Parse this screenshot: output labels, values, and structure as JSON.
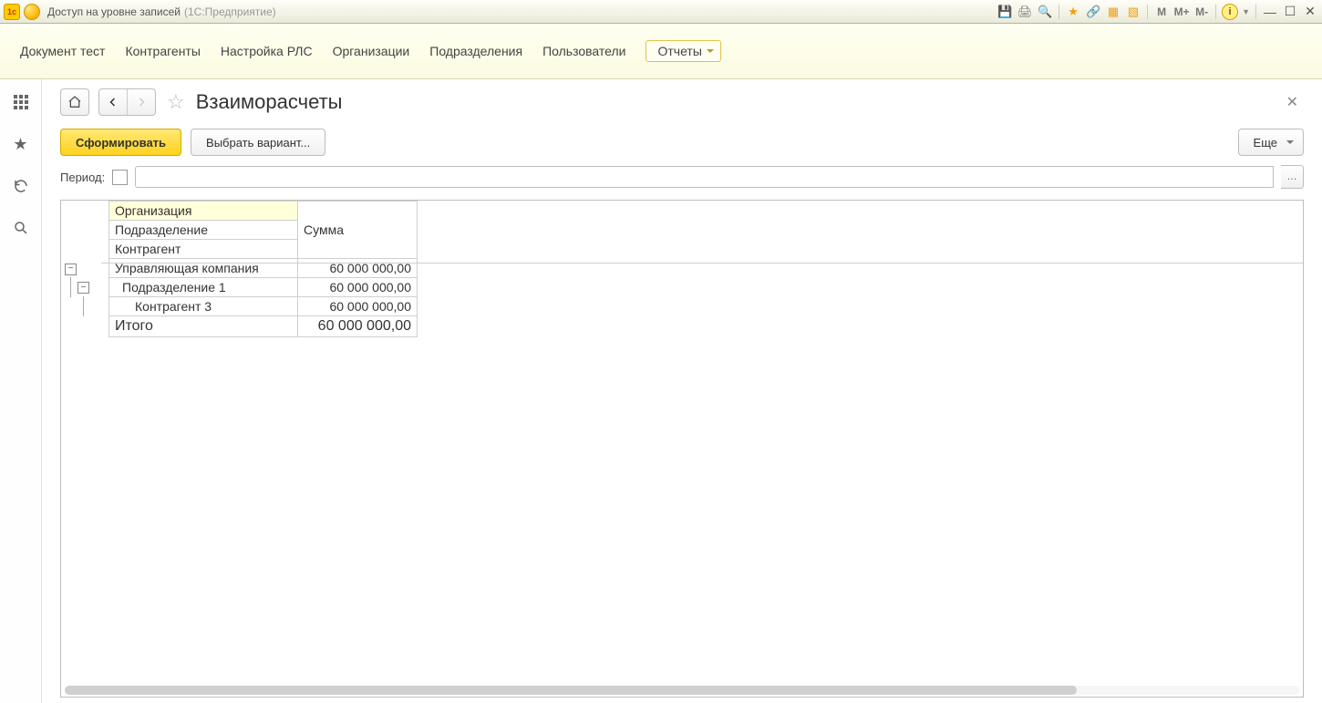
{
  "title_bar": {
    "app_title": "Доступ на уровне записей",
    "app_sub": "(1С:Предприятие)",
    "m_labels": [
      "M",
      "M+",
      "M-"
    ]
  },
  "menu": {
    "items": [
      "Документ тест",
      "Контрагенты",
      "Настройка РЛС",
      "Организации",
      "Подразделения",
      "Пользователи"
    ],
    "dropdown": "Отчеты"
  },
  "page": {
    "title": "Взаиморасчеты"
  },
  "actions": {
    "generate": "Сформировать",
    "variant": "Выбрать вариант...",
    "more": "Еще"
  },
  "filters": {
    "period_label": "Период:"
  },
  "report": {
    "headers": {
      "col1_a": "Организация",
      "col1_b": "Подразделение",
      "col1_c": "Контрагент",
      "col2": "Сумма"
    },
    "rows": [
      {
        "level": 0,
        "name": "Управляющая компания",
        "sum": "60 000 000,00"
      },
      {
        "level": 1,
        "name": "Подразделение 1",
        "sum": "60 000 000,00"
      },
      {
        "level": 2,
        "name": "Контрагент 3",
        "sum": "60 000 000,00"
      }
    ],
    "total": {
      "label": "Итого",
      "sum": "60 000 000,00"
    }
  }
}
